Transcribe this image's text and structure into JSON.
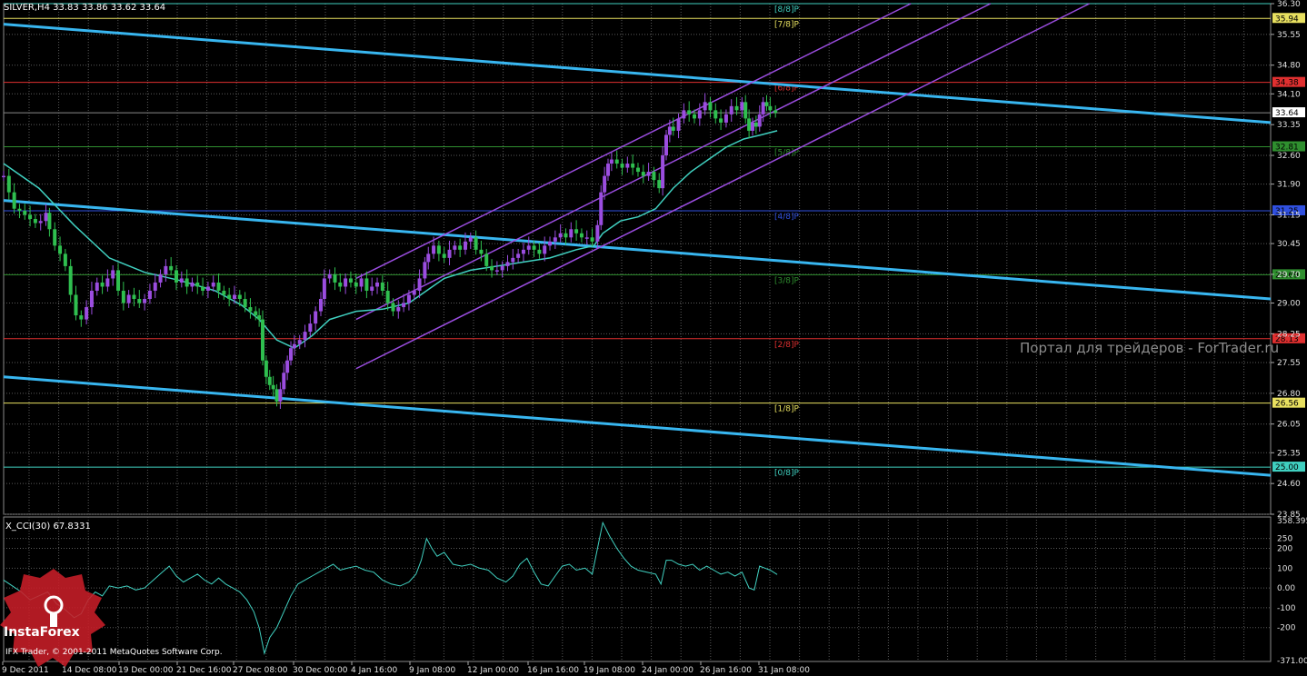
{
  "header": {
    "symbol_line": "SILVER,H4  33.83 33.86 33.62 33.64",
    "cci_line": "X_CCI(30) 67.8331"
  },
  "watermark": "Портал для трейдеров - ForTrader.ru",
  "logo": {
    "text": "InstaForex"
  },
  "copyright": "IFX Trader, © 2001-2011 MetaQuotes Software Corp.",
  "colors": {
    "background": "#000000",
    "grid": "#5a5a5a",
    "bull_candle": "#9b4de0",
    "bear_candle": "#2fbf4f",
    "moving_average": "#40d0c0",
    "regression_channel": "#38b6f0",
    "trend_channel": "#9b4de0",
    "cci_line": "#40d0c0",
    "current_price_label": "#ffffff"
  },
  "chart_data": [
    {
      "type": "candlestick",
      "symbol": "SILVER",
      "timeframe": "H4",
      "ohlc_last": {
        "open": 33.83,
        "high": 33.86,
        "low": 33.62,
        "close": 33.64
      },
      "ylim": [
        23.85,
        36.3
      ],
      "y_ticks": [
        "36.30",
        "35.55",
        "34.80",
        "34.10",
        "33.35",
        "32.60",
        "31.90",
        "31.15",
        "30.45",
        "29.70",
        "29.00",
        "28.25",
        "27.55",
        "26.80",
        "26.05",
        "25.35",
        "24.60",
        "23.85"
      ],
      "x_ticks": [
        "9 Dec 2011",
        "14 Dec 08:00",
        "19 Dec 00:00",
        "21 Dec 16:00",
        "27 Dec 08:00",
        "30 Dec 00:00",
        "4 Jan 16:00",
        "9 Jan 08:00",
        "12 Jan 00:00",
        "16 Jan 16:00",
        "19 Jan 08:00",
        "24 Jan 00:00",
        "26 Jan 16:00",
        "31 Jan 08:00"
      ],
      "close_path": [
        [
          0,
          32.1
        ],
        [
          6,
          31.7
        ],
        [
          12,
          31.3
        ],
        [
          18,
          31.25
        ],
        [
          24,
          31.15
        ],
        [
          30,
          31.05
        ],
        [
          36,
          30.95
        ],
        [
          42,
          31.0
        ],
        [
          48,
          31.2
        ],
        [
          52,
          30.8
        ],
        [
          58,
          30.4
        ],
        [
          64,
          30.2
        ],
        [
          70,
          29.9
        ],
        [
          76,
          29.2
        ],
        [
          82,
          28.7
        ],
        [
          88,
          28.6
        ],
        [
          94,
          28.9
        ],
        [
          100,
          29.3
        ],
        [
          106,
          29.5
        ],
        [
          112,
          29.4
        ],
        [
          118,
          29.6
        ],
        [
          124,
          29.8
        ],
        [
          130,
          29.3
        ],
        [
          136,
          29.0
        ],
        [
          142,
          29.2
        ],
        [
          148,
          29.1
        ],
        [
          154,
          29.0
        ],
        [
          160,
          29.1
        ],
        [
          166,
          29.3
        ],
        [
          172,
          29.5
        ],
        [
          178,
          29.7
        ],
        [
          184,
          29.9
        ],
        [
          190,
          29.8
        ],
        [
          196,
          29.5
        ],
        [
          202,
          29.6
        ],
        [
          208,
          29.4
        ],
        [
          214,
          29.5
        ],
        [
          220,
          29.4
        ],
        [
          226,
          29.3
        ],
        [
          232,
          29.4
        ],
        [
          238,
          29.5
        ],
        [
          244,
          29.3
        ],
        [
          250,
          29.2
        ],
        [
          256,
          29.1
        ],
        [
          262,
          29.2
        ],
        [
          268,
          29.1
        ],
        [
          274,
          28.9
        ],
        [
          280,
          28.8
        ],
        [
          286,
          28.7
        ],
        [
          290,
          28.6
        ],
        [
          294,
          27.6
        ],
        [
          298,
          27.2
        ],
        [
          302,
          27.0
        ],
        [
          306,
          26.9
        ],
        [
          310,
          26.6
        ],
        [
          314,
          26.9
        ],
        [
          318,
          27.3
        ],
        [
          322,
          27.6
        ],
        [
          326,
          27.9
        ],
        [
          330,
          28.0
        ],
        [
          336,
          28.1
        ],
        [
          342,
          28.3
        ],
        [
          348,
          28.5
        ],
        [
          354,
          28.8
        ],
        [
          360,
          29.1
        ],
        [
          364,
          29.6
        ],
        [
          370,
          29.7
        ],
        [
          376,
          29.5
        ],
        [
          382,
          29.4
        ],
        [
          388,
          29.6
        ],
        [
          394,
          29.5
        ],
        [
          400,
          29.4
        ],
        [
          406,
          29.6
        ],
        [
          412,
          29.3
        ],
        [
          418,
          29.4
        ],
        [
          424,
          29.5
        ],
        [
          430,
          29.3
        ],
        [
          436,
          29.0
        ],
        [
          442,
          28.8
        ],
        [
          448,
          28.9
        ],
        [
          454,
          29.0
        ],
        [
          460,
          29.2
        ],
        [
          466,
          29.3
        ],
        [
          472,
          29.6
        ],
        [
          478,
          30.0
        ],
        [
          482,
          30.2
        ],
        [
          488,
          30.4
        ],
        [
          494,
          30.2
        ],
        [
          500,
          30.1
        ],
        [
          506,
          30.3
        ],
        [
          512,
          30.4
        ],
        [
          518,
          30.3
        ],
        [
          524,
          30.5
        ],
        [
          530,
          30.6
        ],
        [
          536,
          30.3
        ],
        [
          542,
          30.2
        ],
        [
          548,
          29.9
        ],
        [
          554,
          29.8
        ],
        [
          560,
          29.8
        ],
        [
          566,
          29.9
        ],
        [
          572,
          30.0
        ],
        [
          578,
          30.1
        ],
        [
          584,
          30.2
        ],
        [
          590,
          30.3
        ],
        [
          596,
          30.4
        ],
        [
          602,
          30.3
        ],
        [
          608,
          30.2
        ],
        [
          614,
          30.4
        ],
        [
          620,
          30.5
        ],
        [
          626,
          30.6
        ],
        [
          632,
          30.7
        ],
        [
          638,
          30.6
        ],
        [
          644,
          30.8
        ],
        [
          650,
          30.7
        ],
        [
          656,
          30.6
        ],
        [
          662,
          30.6
        ],
        [
          668,
          30.5
        ],
        [
          674,
          30.9
        ],
        [
          678,
          31.7
        ],
        [
          682,
          32.1
        ],
        [
          686,
          32.4
        ],
        [
          690,
          32.5
        ],
        [
          696,
          32.4
        ],
        [
          702,
          32.3
        ],
        [
          708,
          32.4
        ],
        [
          714,
          32.3
        ],
        [
          720,
          32.2
        ],
        [
          726,
          32.1
        ],
        [
          732,
          32.2
        ],
        [
          738,
          32.0
        ],
        [
          744,
          31.8
        ],
        [
          748,
          32.6
        ],
        [
          752,
          33.1
        ],
        [
          756,
          33.3
        ],
        [
          760,
          33.2
        ],
        [
          766,
          33.5
        ],
        [
          772,
          33.7
        ],
        [
          778,
          33.6
        ],
        [
          784,
          33.5
        ],
        [
          790,
          33.7
        ],
        [
          796,
          33.9
        ],
        [
          802,
          33.7
        ],
        [
          808,
          33.5
        ],
        [
          814,
          33.4
        ],
        [
          820,
          33.6
        ],
        [
          826,
          33.8
        ],
        [
          832,
          33.7
        ],
        [
          838,
          33.9
        ],
        [
          842,
          33.5
        ],
        [
          846,
          33.2
        ],
        [
          850,
          33.4
        ],
        [
          854,
          33.3
        ],
        [
          858,
          33.6
        ],
        [
          862,
          33.9
        ],
        [
          866,
          33.8
        ],
        [
          870,
          33.7
        ],
        [
          876,
          33.64
        ]
      ],
      "moving_average": [
        [
          0,
          32.4
        ],
        [
          40,
          31.8
        ],
        [
          80,
          30.9
        ],
        [
          120,
          30.1
        ],
        [
          160,
          29.75
        ],
        [
          200,
          29.55
        ],
        [
          240,
          29.3
        ],
        [
          270,
          28.95
        ],
        [
          290,
          28.6
        ],
        [
          310,
          28.1
        ],
        [
          330,
          27.9
        ],
        [
          350,
          28.2
        ],
        [
          370,
          28.6
        ],
        [
          400,
          28.8
        ],
        [
          430,
          28.85
        ],
        [
          460,
          29.0
        ],
        [
          480,
          29.3
        ],
        [
          500,
          29.6
        ],
        [
          530,
          29.8
        ],
        [
          560,
          29.9
        ],
        [
          590,
          30.0
        ],
        [
          620,
          30.1
        ],
        [
          650,
          30.3
        ],
        [
          670,
          30.4
        ],
        [
          680,
          30.7
        ],
        [
          700,
          31.0
        ],
        [
          720,
          31.1
        ],
        [
          740,
          31.3
        ],
        [
          760,
          31.8
        ],
        [
          780,
          32.2
        ],
        [
          800,
          32.5
        ],
        [
          820,
          32.8
        ],
        [
          840,
          33.0
        ],
        [
          860,
          33.1
        ],
        [
          878,
          33.2
        ]
      ],
      "murrey_levels": [
        {
          "label": "[8/8]P",
          "value": 36.3,
          "color": "#40d0c0",
          "show_box": false
        },
        {
          "label": "[7/8]P",
          "value": 35.94,
          "color": "#e8e060",
          "show_box": true
        },
        {
          "label": "[6/8]P",
          "value": 34.38,
          "color": "#e03030",
          "show_box": true
        },
        {
          "label": "[5/8]P",
          "value": 32.81,
          "color": "#2f8f2f",
          "show_box": true
        },
        {
          "label": "[4/8]P",
          "value": 31.25,
          "color": "#3050e0",
          "show_box": true
        },
        {
          "label": "[3/8]P",
          "value": 29.69,
          "color": "#2f8f2f",
          "show_box": true
        },
        {
          "label": "[2/8]P",
          "value": 28.13,
          "color": "#e03030",
          "show_box": true
        },
        {
          "label": "[1/8]P",
          "value": 26.56,
          "color": "#e8e060",
          "show_box": true
        },
        {
          "label": "[0/8]P",
          "value": 25.0,
          "color": "#40d0c0",
          "show_box": true
        }
      ],
      "murrey_box_labels": [
        "35.94",
        "34.38",
        "32.81",
        "31.25",
        "29.69",
        "28.13",
        "26.56",
        "25.00"
      ],
      "current_price": {
        "value": 33.64,
        "label": "33.64"
      },
      "regression_channel": [
        {
          "name": "upper",
          "start": [
            0,
            35.8
          ],
          "end": [
            1438,
            33.4
          ]
        },
        {
          "name": "middle",
          "start": [
            0,
            31.5
          ],
          "end": [
            1438,
            29.1
          ]
        },
        {
          "name": "lower",
          "start": [
            0,
            27.2
          ],
          "end": [
            1438,
            24.8
          ]
        }
      ],
      "trend_channel": [
        {
          "name": "upper",
          "start": [
            400,
            29.6
          ],
          "end": [
            1180,
            37.9
          ]
        },
        {
          "name": "middle",
          "start": [
            400,
            28.6
          ],
          "end": [
            1438,
            39.7
          ]
        },
        {
          "name": "lower",
          "start": [
            400,
            27.4
          ],
          "end": [
            1438,
            38.5
          ]
        }
      ]
    },
    {
      "type": "line",
      "name": "X_CCI(30)",
      "ylim": [
        -371.0,
        358.395
      ],
      "y_ticks": [
        "358.395",
        "250",
        "200",
        "100",
        "0.00",
        "-100",
        "-200",
        "-371.00"
      ],
      "values": [
        [
          0,
          40
        ],
        [
          10,
          10
        ],
        [
          20,
          -20
        ],
        [
          30,
          -60
        ],
        [
          40,
          -40
        ],
        [
          50,
          -20
        ],
        [
          60,
          -80
        ],
        [
          70,
          -110
        ],
        [
          80,
          -150
        ],
        [
          88,
          -130
        ],
        [
          96,
          -60
        ],
        [
          104,
          -20
        ],
        [
          112,
          -40
        ],
        [
          120,
          10
        ],
        [
          130,
          0
        ],
        [
          140,
          10
        ],
        [
          150,
          -10
        ],
        [
          160,
          0
        ],
        [
          170,
          40
        ],
        [
          180,
          80
        ],
        [
          188,
          110
        ],
        [
          196,
          60
        ],
        [
          204,
          30
        ],
        [
          212,
          50
        ],
        [
          220,
          70
        ],
        [
          228,
          40
        ],
        [
          236,
          20
        ],
        [
          244,
          50
        ],
        [
          252,
          20
        ],
        [
          260,
          0
        ],
        [
          268,
          -20
        ],
        [
          276,
          -60
        ],
        [
          284,
          -120
        ],
        [
          290,
          -200
        ],
        [
          296,
          -330
        ],
        [
          302,
          -250
        ],
        [
          310,
          -200
        ],
        [
          318,
          -120
        ],
        [
          326,
          -40
        ],
        [
          334,
          20
        ],
        [
          342,
          40
        ],
        [
          350,
          60
        ],
        [
          358,
          80
        ],
        [
          366,
          100
        ],
        [
          374,
          120
        ],
        [
          382,
          90
        ],
        [
          390,
          100
        ],
        [
          400,
          110
        ],
        [
          410,
          90
        ],
        [
          420,
          80
        ],
        [
          430,
          40
        ],
        [
          440,
          20
        ],
        [
          450,
          10
        ],
        [
          460,
          30
        ],
        [
          468,
          70
        ],
        [
          474,
          140
        ],
        [
          480,
          250
        ],
        [
          486,
          200
        ],
        [
          492,
          160
        ],
        [
          500,
          180
        ],
        [
          510,
          120
        ],
        [
          520,
          110
        ],
        [
          530,
          120
        ],
        [
          540,
          100
        ],
        [
          550,
          90
        ],
        [
          560,
          50
        ],
        [
          570,
          30
        ],
        [
          578,
          60
        ],
        [
          586,
          120
        ],
        [
          594,
          150
        ],
        [
          602,
          80
        ],
        [
          610,
          20
        ],
        [
          618,
          10
        ],
        [
          626,
          60
        ],
        [
          634,
          110
        ],
        [
          642,
          120
        ],
        [
          650,
          90
        ],
        [
          660,
          100
        ],
        [
          668,
          70
        ],
        [
          674,
          200
        ],
        [
          680,
          330
        ],
        [
          688,
          260
        ],
        [
          696,
          200
        ],
        [
          704,
          150
        ],
        [
          712,
          110
        ],
        [
          720,
          90
        ],
        [
          730,
          80
        ],
        [
          740,
          70
        ],
        [
          746,
          20
        ],
        [
          752,
          140
        ],
        [
          758,
          140
        ],
        [
          766,
          120
        ],
        [
          774,
          110
        ],
        [
          782,
          120
        ],
        [
          790,
          90
        ],
        [
          798,
          110
        ],
        [
          806,
          90
        ],
        [
          814,
          70
        ],
        [
          822,
          80
        ],
        [
          830,
          60
        ],
        [
          838,
          80
        ],
        [
          846,
          0
        ],
        [
          852,
          -10
        ],
        [
          858,
          110
        ],
        [
          864,
          100
        ],
        [
          870,
          90
        ],
        [
          878,
          68
        ]
      ]
    }
  ]
}
